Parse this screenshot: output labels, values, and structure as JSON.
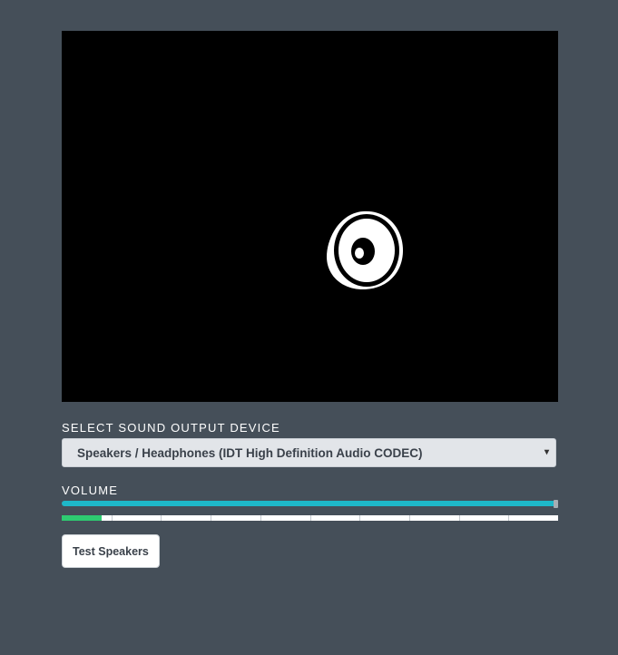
{
  "preview": {
    "icon": "speaker-icon"
  },
  "device": {
    "label": "SELECT SOUND OUTPUT DEVICE",
    "selected": "Speakers / Headphones (IDT High Definition Audio CODEC)",
    "arrow": "▾"
  },
  "volume": {
    "label": "VOLUME",
    "level": 1.0,
    "accent": "#1eb8c9"
  },
  "meter": {
    "level": 0.08,
    "segments": 10,
    "color": "#2ecc71"
  },
  "actions": {
    "test_label": "Test Speakers"
  }
}
